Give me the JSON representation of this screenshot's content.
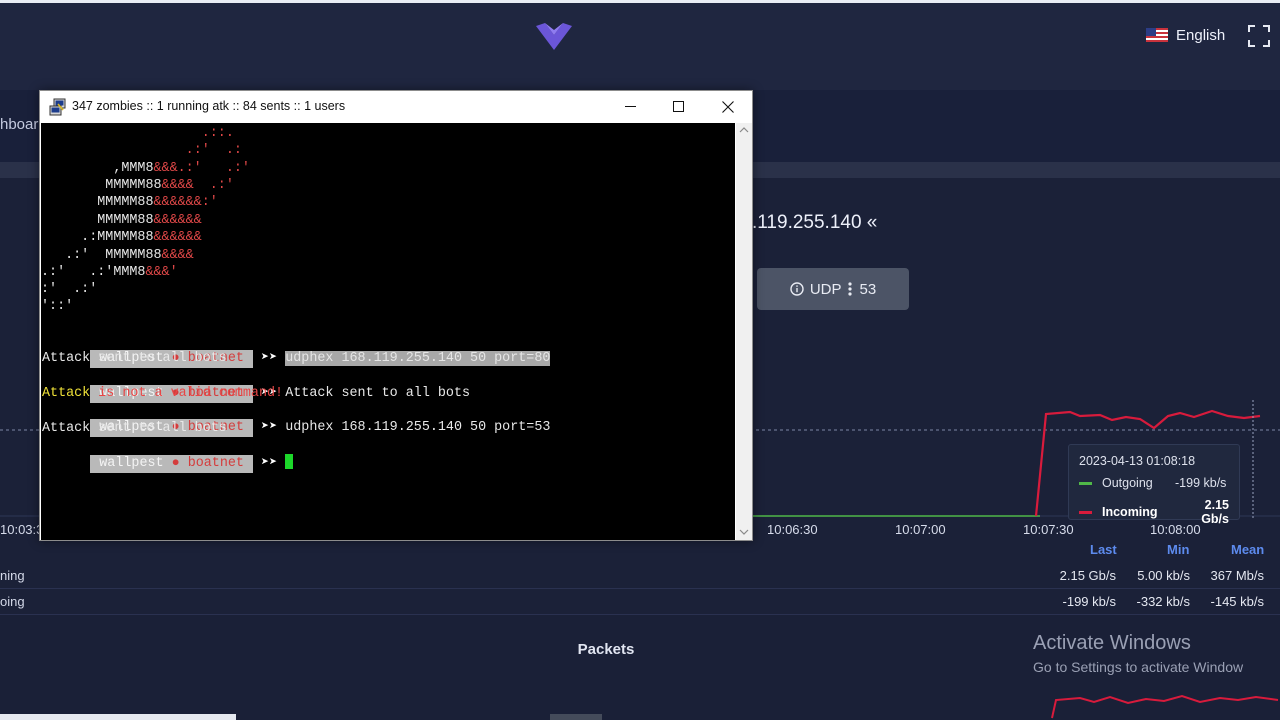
{
  "header": {
    "language": "English",
    "icons": [
      "logo-icon",
      "us-flag-icon",
      "fullscreen-icon"
    ]
  },
  "nav": {
    "crumb": "hboard"
  },
  "attack": {
    "target": ".119.255.140 «",
    "method": "UDP",
    "value": "53"
  },
  "chart": {
    "x_ticks": [
      "10:03:3",
      "10:06:30",
      "10:07:00",
      "10:07:30",
      "10:08:00"
    ],
    "tooltip": {
      "time": "2023-04-13 01:08:18",
      "outgoing_label": "Outgoing",
      "outgoing_value": "-199 kb/s",
      "incoming_label": "Incoming",
      "incoming_value": "2.15 Gb/s"
    },
    "colors": {
      "outgoing": "#50b848",
      "incoming": "#d81b3c"
    }
  },
  "stats": {
    "headers": [
      "Last",
      "Min",
      "Mean"
    ],
    "rows": [
      {
        "label": "ning",
        "last": "2.15 Gb/s",
        "min": "5.00 kb/s",
        "mean": "367 Mb/s"
      },
      {
        "label": "oing",
        "last": "-199 kb/s",
        "min": "-332 kb/s",
        "mean": "-145 kb/s"
      }
    ]
  },
  "packets": {
    "title": "Packets"
  },
  "watermark": {
    "title": "Activate Windows",
    "subtitle": "Go to Settings to activate Window"
  },
  "terminal": {
    "title": "347 zombies :: 1 running atk :: 84 sents :: 1 users",
    "prompt_user": "wallpest",
    "prompt_sep": "●",
    "prompt_host": "boatnet",
    "chevron": "➤➤",
    "cmd1": "udphex 168.119.255.140 50 port=80",
    "out1": "Attack sent to all bots",
    "cmd2": "Attack sent to all bots",
    "out2_a": "Attack",
    "out2_b": " is not a valid command!",
    "cmd3": "udphex 168.119.255.140 50 port=53",
    "out3": "Attack sent to all bots",
    "ascii_art": [
      [
        "                    ",
        ".::.",
        ""
      ],
      [
        "                  ",
        ".:'  .:",
        ""
      ],
      [
        "         ,MMM8",
        "&&&.:'   .:'",
        ""
      ],
      [
        "        MMMMM88",
        "&&&&",
        "  .:'"
      ],
      [
        "       MMMMM88",
        "&&&&&&:'",
        ""
      ],
      [
        "       MMMMM88",
        "&&&&&&",
        ""
      ],
      [
        "     .:MMMMM88",
        "&&&&&&",
        ""
      ],
      [
        "   .:'  MMMMM88",
        "&&&&",
        ""
      ],
      [
        ".:'   .:'MMM8",
        "&&&'",
        ""
      ],
      [
        ":'  .:'",
        "",
        ""
      ],
      [
        "'::'",
        "",
        ""
      ]
    ]
  }
}
